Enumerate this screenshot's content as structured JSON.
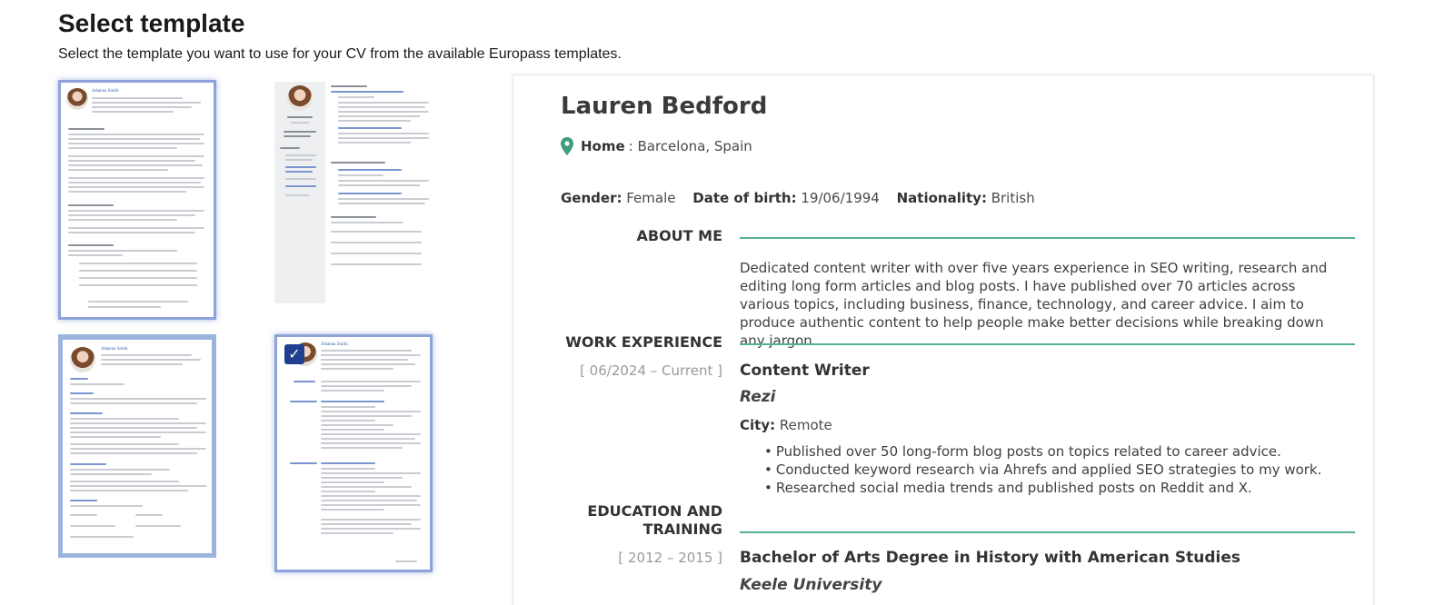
{
  "header": {
    "title": "Select template",
    "subtitle": "Select the template you want to use for your CV from the available Europass templates."
  },
  "thumbnails": {
    "sample_name": "Johanna Smith",
    "selected_icon": "checkmark-icon"
  },
  "cv": {
    "name": "Lauren Bedford",
    "home_label": "Home",
    "home_value": " : Barcelona, Spain",
    "gender_label": "Gender:",
    "gender_value": " Female",
    "dob_label": "Date of birth:",
    "dob_value": " 19/06/1994",
    "nationality_label": "Nationality:",
    "nationality_value": " British",
    "about_heading": "ABOUT ME",
    "about_text": "Dedicated content writer with over five years experience in SEO writing, research and editing long form articles and blog posts. I have published over 70 articles across various topics, including business, finance, technology, and career advice. I aim to produce authentic content to help people make better decisions while breaking down any jargon.",
    "work_heading": "WORK EXPERIENCE",
    "work": {
      "dates": "[ 06/2024 – Current ]",
      "title": "Content Writer",
      "company": "Rezi",
      "city_label": "City:",
      "city_value": " Remote",
      "bullets": [
        "Published over 50 long-form blog posts on topics related to career advice.",
        "Conducted keyword research via Ahrefs and applied SEO strategies to my work.",
        "Researched social media trends and published posts on Reddit and X."
      ]
    },
    "education_heading_line1": "EDUCATION AND",
    "education_heading_line2": "TRAINING",
    "education": {
      "dates": "[ 2012 – 2015 ]",
      "degree": "Bachelor of Arts Degree in History with American Studies",
      "school": "Keele University"
    }
  },
  "colors": {
    "accent_rule": "#56b095",
    "thumb_border": "#8ea3d9",
    "check_bg": "#1f3f8f"
  }
}
